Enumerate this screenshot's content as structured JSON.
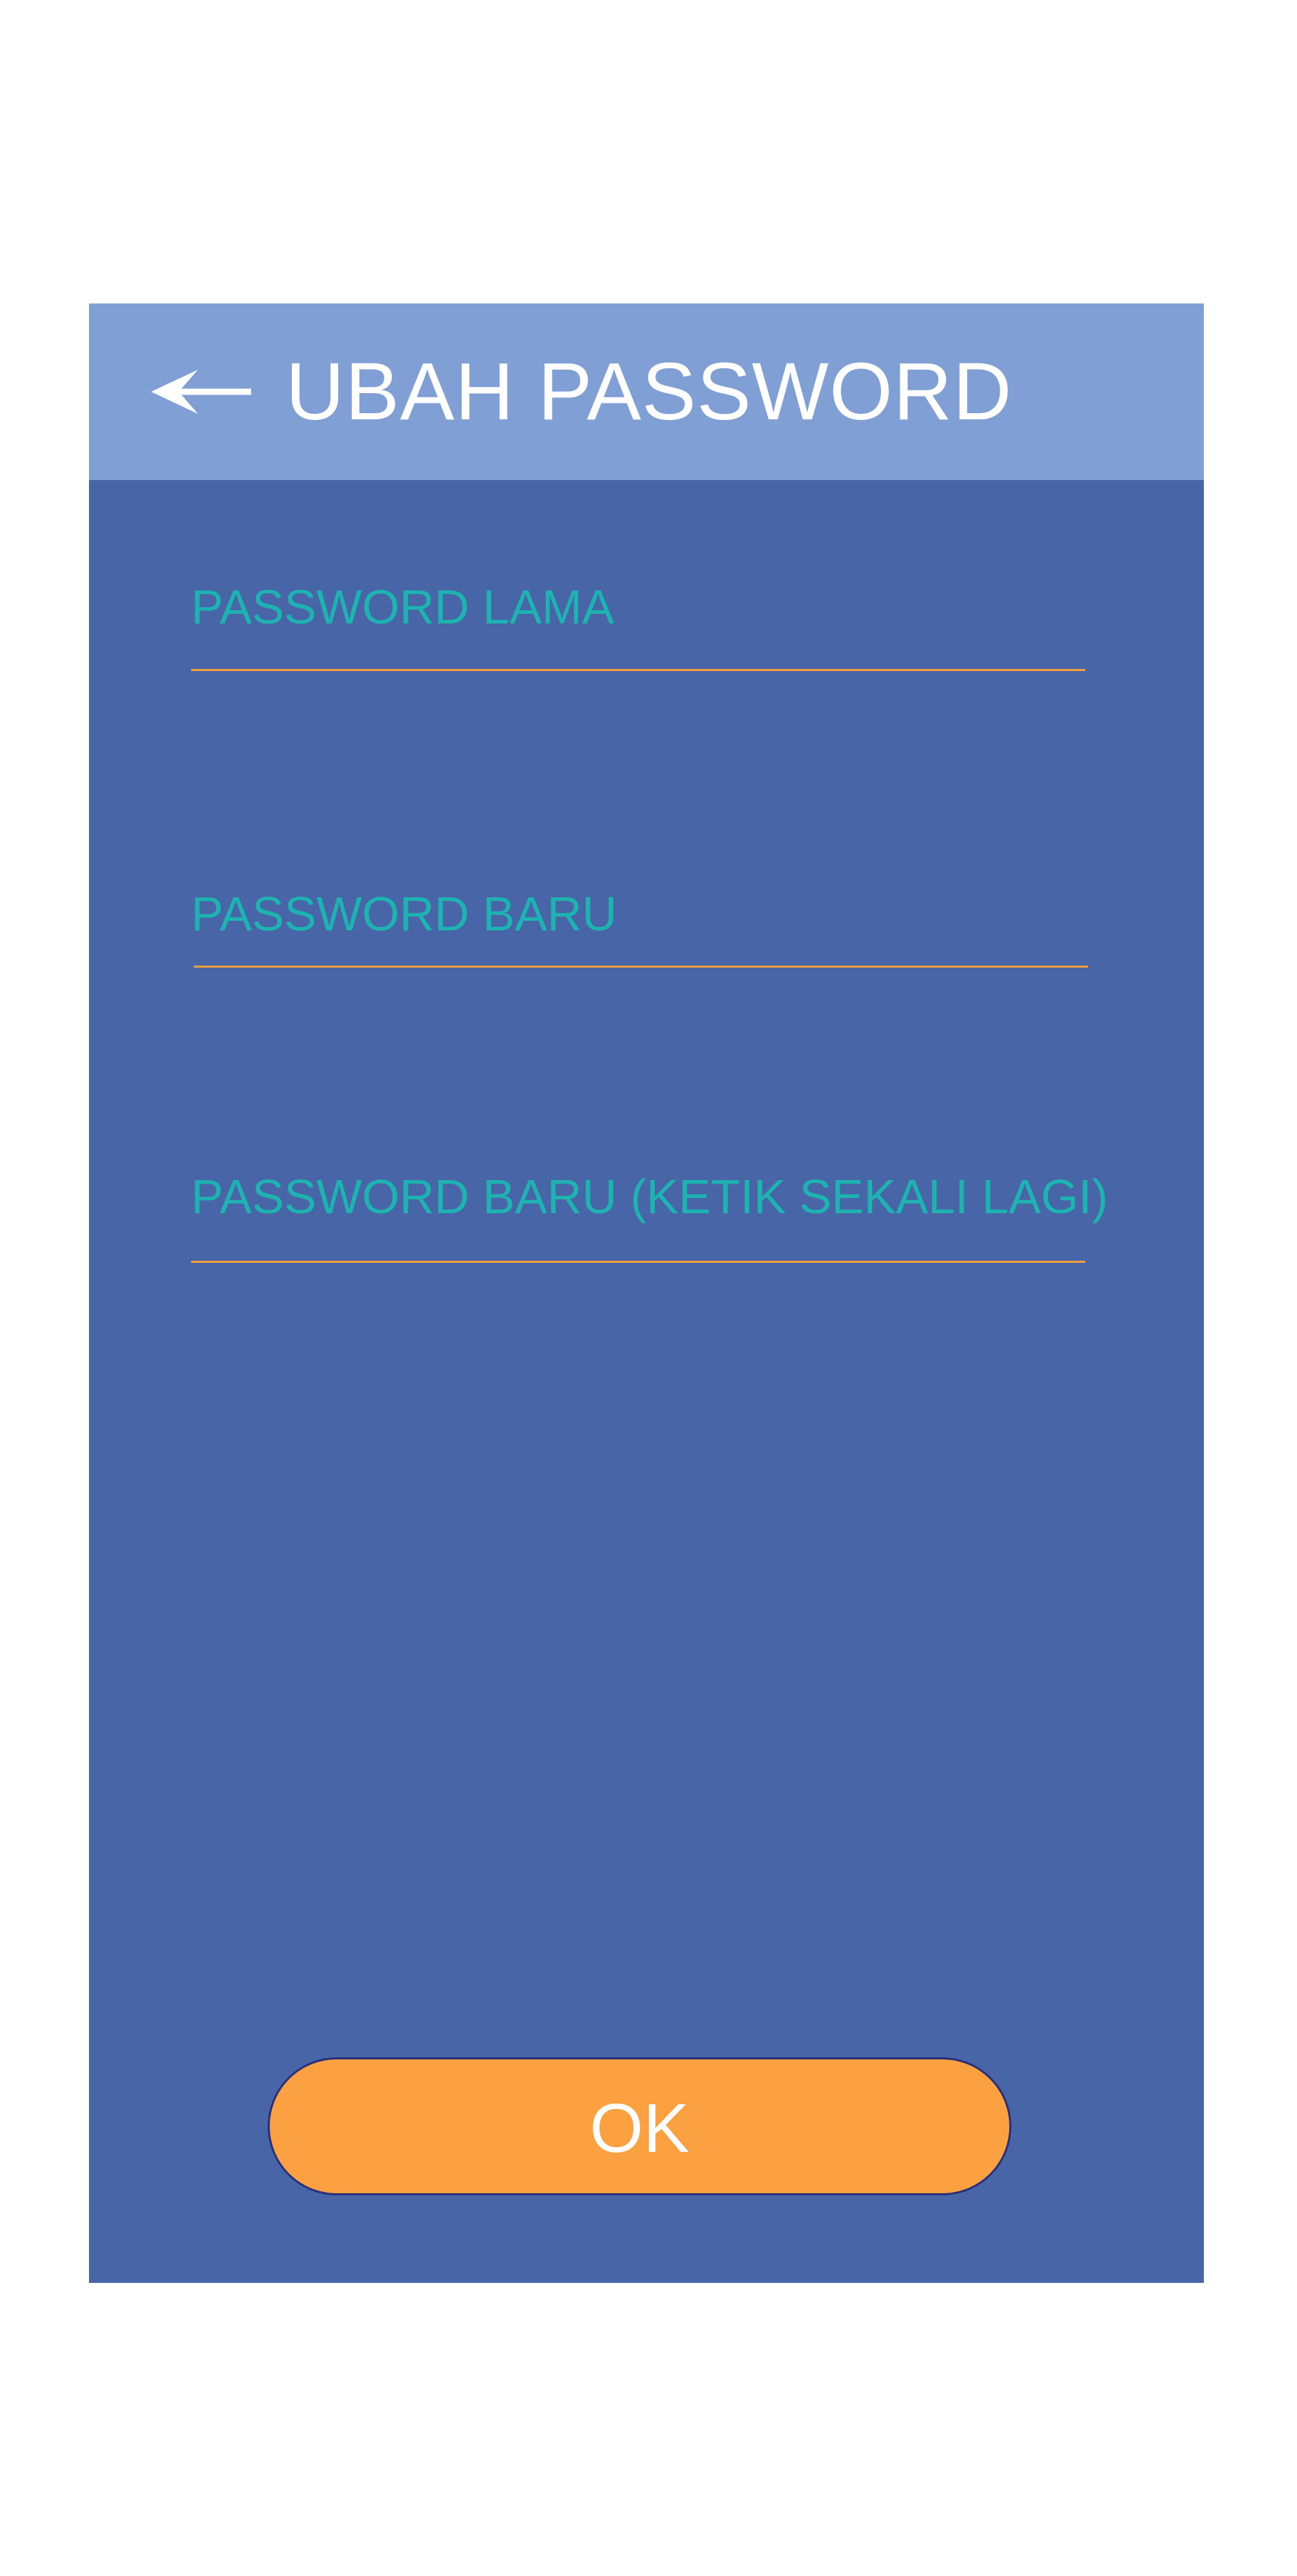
{
  "header": {
    "title": "UBAH PASSWORD",
    "back_icon": "arrow-left-icon"
  },
  "fields": [
    {
      "label": "PASSWORD LAMA",
      "value": "",
      "placeholder": ""
    },
    {
      "label": "PASSWORD BARU",
      "value": "",
      "placeholder": ""
    },
    {
      "label": "PASSWORD BARU (KETIK SEKALI LAGI)",
      "value": "",
      "placeholder": ""
    }
  ],
  "actions": {
    "ok_label": "OK"
  },
  "colors": {
    "page_background": "#ffffff",
    "content_background": "#4865a8",
    "header_background": "#7f9fd5",
    "label_text": "#1cb3b0",
    "input_underline": "#f59e3b",
    "button_fill": "#fba142",
    "button_border": "#2a2f7a",
    "header_text": "#ffffff"
  }
}
